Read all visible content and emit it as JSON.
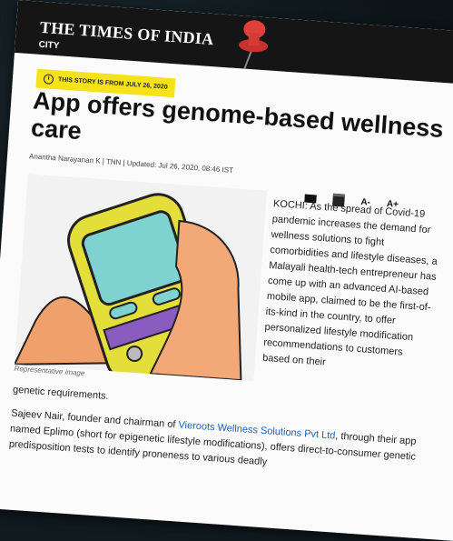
{
  "masthead": "THE TIMES OF INDIA",
  "section": "CITY",
  "badge": "THIS STORY IS FROM JULY 26, 2020",
  "headline": "App offers genome-based wellness care",
  "byline": "Anantha Narayanan K | TNN | Updated: Jul 26, 2020, 08:46 IST",
  "tools": {
    "mail": "mail-icon",
    "print": "print-icon",
    "font_down": "A-",
    "font_up": "A+"
  },
  "caption": "Representative image",
  "para1_side": "KOCHI: As the spread of Covid-19 pandemic increases the demand for wellness solutions to fight comorbidities and lifestyle diseases, a Malayali health-tech entrepreneur has come up with an advanced AI-based mobile app, claimed to be the first-of-its-kind in the country, to offer personalized lifestyle modification recommendations to customers based on their",
  "para1_tail": "genetic requirements.",
  "para2_before": "Sajeev Nair, founder and chairman of ",
  "para2_link": "Vieroots Wellness Solutions Pvt Ltd",
  "para2_after": ", through their app named Eplimo (short for epigenetic lifestyle modifications), offers direct-to-consumer genetic predisposition tests to identify proneness to various deadly"
}
